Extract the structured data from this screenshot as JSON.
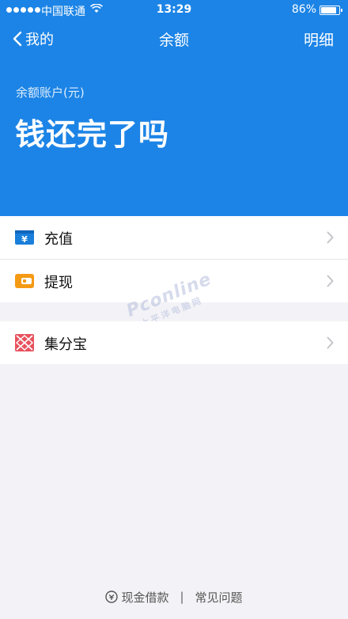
{
  "status_bar": {
    "carrier": "中国联通",
    "time": "13:29",
    "battery": "86%",
    "battery_level": 0.86
  },
  "nav": {
    "back_label": "我的",
    "title": "余额",
    "detail_label": "明细"
  },
  "balance": {
    "label": "余额账户(元)",
    "value": "钱还完了吗"
  },
  "menu": [
    {
      "label": "充值",
      "icon": "recharge-icon",
      "color": "#1a7fdb"
    },
    {
      "label": "提现",
      "icon": "wallet-icon",
      "color": "#f59a14"
    },
    {
      "label": "集分宝",
      "icon": "jifenbao-icon",
      "color": "#e8525e"
    }
  ],
  "footer": {
    "loan": "现金借款",
    "separator": "|",
    "faq": "常见问题"
  },
  "watermark": {
    "main": "Pconline",
    "sub": "太平洋电脑网"
  },
  "colors": {
    "header_bg": "#1c84e6",
    "page_bg": "#f3f3f7"
  }
}
